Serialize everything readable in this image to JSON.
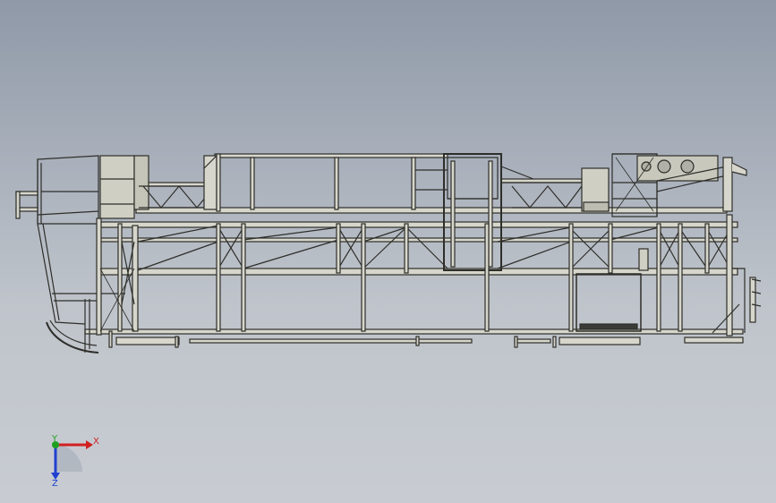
{
  "viewport": {
    "background_top": "#9aa3b0",
    "background_bottom": "#d6d9de"
  },
  "model": {
    "view": "front",
    "frame_color": "#d6d6cc",
    "edge_color": "#2e2e2a",
    "shadow_color": "#8c8f8c"
  },
  "triad": {
    "x_label": "X",
    "y_label": "Y",
    "z_label": "Z",
    "x_color": "#d02020",
    "y_color": "#20a020",
    "z_color": "#2040d0"
  }
}
